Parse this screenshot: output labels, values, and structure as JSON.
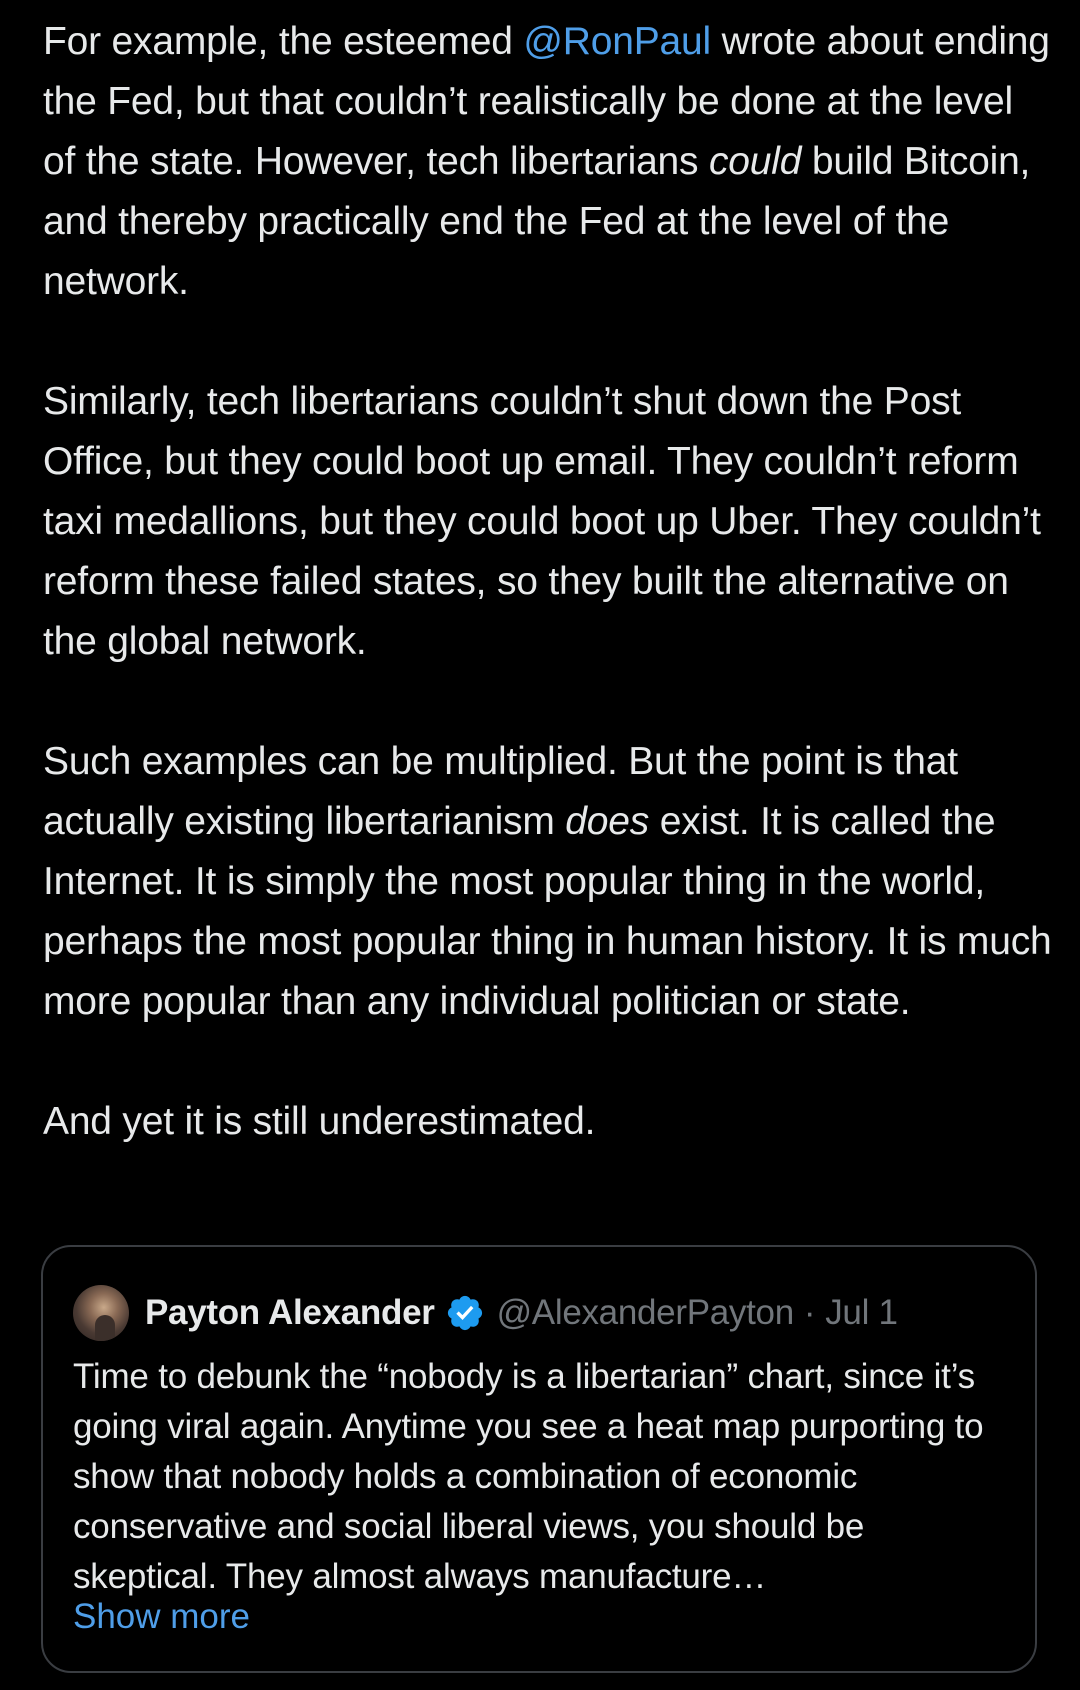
{
  "colors": {
    "background": "#000000",
    "text": "#e7e9ea",
    "link": "#4f9ee8",
    "muted": "#71767b",
    "border": "#3a3d42",
    "verified": "#1d9bf0"
  },
  "tweet": {
    "p1": {
      "before": "For example, the esteemed ",
      "mention": "@RonPaul",
      "after1": " wrote about ending the Fed, but that couldn’t realistically be done at the level of the state. However, tech libertarians ",
      "em": "could",
      "after2": " build Bitcoin, and thereby practically end the Fed at the level of the network."
    },
    "p2": "Similarly, tech libertarians couldn’t shut down the Post Office, but they could boot up email. They couldn’t reform taxi medallions, but they could boot up Uber. They couldn’t reform these failed states, so they built the alternative on the global network.",
    "p3": {
      "before": "Such examples can be multiplied. But the point is that actually existing libertarianism ",
      "em": "does",
      "after": " exist. It is called the Internet. It is simply the most popular thing in the world, perhaps the most popular thing in human history. It is much more popular than any individual politician or state."
    },
    "p4": "And yet it is still underestimated."
  },
  "quote": {
    "author_name": "Payton Alexander",
    "author_handle": "@AlexanderPayton",
    "separator": "·",
    "date": "Jul 1",
    "verified_icon": "verified-badge-icon",
    "text": "Time to debunk the “nobody is a libertarian” chart, since it’s going viral again. Anytime you see a heat map purporting to show that nobody holds a combination of economic conservative and social liberal views, you should be skeptical. They almost always manufacture…",
    "show_more": "Show more"
  }
}
